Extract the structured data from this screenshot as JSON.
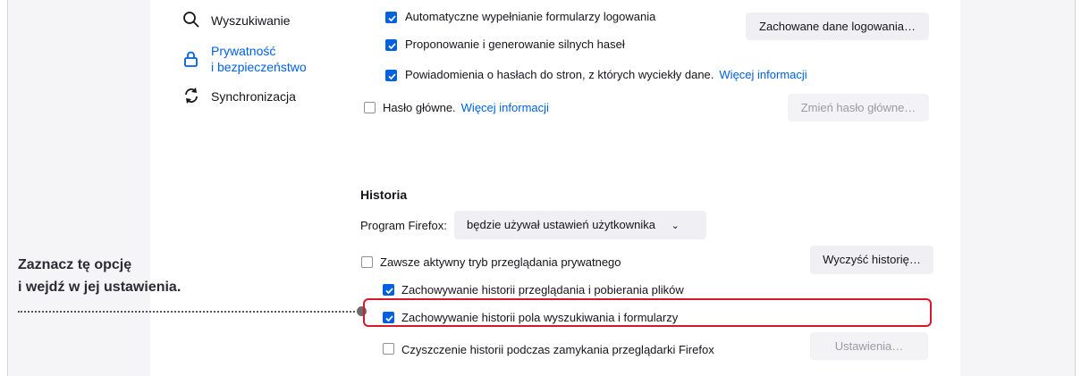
{
  "sidebar": {
    "items": [
      {
        "label": "Wyszukiwanie",
        "icon": "search-icon"
      },
      {
        "label_line1": "Prywatność",
        "label_line2": "i bezpieczeństwo",
        "icon": "lock-icon",
        "active": true
      },
      {
        "label": "Synchronizacja",
        "icon": "sync-icon"
      }
    ]
  },
  "logins": {
    "autofill_label": "Automatyczne wypełnianie formularzy logowania",
    "autofill_checked": true,
    "suggest_label": "Proponowanie i generowanie silnych haseł",
    "suggest_checked": true,
    "breach_label": "Powiadomienia o hasłach do stron, z których wyciekły dane.",
    "breach_link": "Więcej informacji",
    "breach_checked": true,
    "saved_logins_button": "Zachowane dane logowania…",
    "master_label": "Hasło główne.",
    "master_link": "Więcej informacji",
    "master_checked": false,
    "change_master_button": "Zmień hasło główne…"
  },
  "history": {
    "title": "Historia",
    "program_label": "Program Firefox:",
    "mode_value": "będzie używał ustawień użytkownika",
    "private_label": "Zawsze aktywny tryb przeglądania prywatnego",
    "private_checked": false,
    "clear_button": "Wyczyść historię…",
    "browsing_label": "Zachowywanie historii przeglądania i pobierania plików",
    "browsing_checked": true,
    "forms_label": "Zachowywanie historii pola wyszukiwania i formularzy",
    "forms_checked": true,
    "clear_on_close_label": "Czyszczenie historii podczas zamykania przeglądarki Firefox",
    "clear_on_close_checked": false,
    "settings_button": "Ustawienia…"
  },
  "callout": {
    "line1": "Zaznacz tę opcję",
    "line2": "i wejdź w jej ustawienia."
  },
  "colors": {
    "accent": "#0061e0",
    "highlight": "#d7182a"
  }
}
